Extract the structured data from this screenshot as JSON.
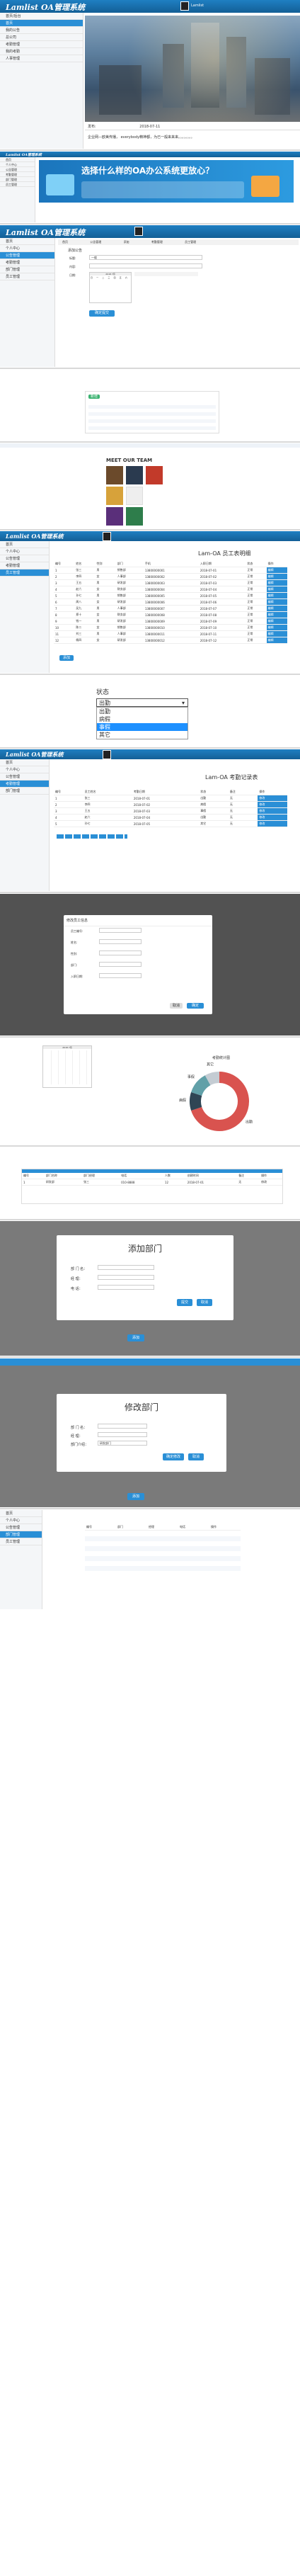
{
  "brand": "Lamlist OA管理系统",
  "user_name": "Lamlist",
  "p1": {
    "side_items": [
      "首页/后台",
      "首页",
      "我的公告",
      "总公司",
      "考勤管理",
      "我的考勤",
      "人事管理"
    ],
    "news_date_label": "发布:",
    "news_date": "2018-07-11",
    "news_text": "企业网—欧美传播， everybody精神都，为已一般来来来。。。。。。。。"
  },
  "p2": {
    "banner_text": "选择什么样的OA办公系统更放心？",
    "side_items": [
      "首页",
      "个人中心",
      "公告管理",
      "考勤管理",
      "部门管理",
      "员工管理"
    ]
  },
  "p3": {
    "tabs": [
      "首页",
      "公告管理",
      "添加",
      "考勤管理",
      "员工管理"
    ],
    "form_title": "添加公告",
    "labels": [
      "标题:",
      "内容:",
      "日期:"
    ],
    "title_val": "一般",
    "calendar_month": "2018 7月",
    "week": [
      "日",
      "一",
      "二",
      "三",
      "四",
      "五",
      "六"
    ],
    "submit": "确定提交"
  },
  "p4": {
    "tab": "公告列表",
    "btn": "新增"
  },
  "p5": {
    "heading": "MEET OUR TEAM"
  },
  "p6": {
    "table_title": "Lam-OA 员工表明细",
    "columns": [
      "编号",
      "姓名",
      "性别",
      "部门",
      "手机",
      "入职日期",
      "状态",
      "操作"
    ],
    "rows": [
      [
        "1",
        "张三",
        "男",
        "销售部",
        "13800000001",
        "2018-07-01",
        "正常",
        "编辑"
      ],
      [
        "2",
        "李四",
        "女",
        "人事部",
        "13800000002",
        "2018-07-02",
        "正常",
        "编辑"
      ],
      [
        "3",
        "王五",
        "男",
        "研发部",
        "13800000003",
        "2018-07-03",
        "正常",
        "编辑"
      ],
      [
        "4",
        "赵六",
        "女",
        "财务部",
        "13800000004",
        "2018-07-04",
        "正常",
        "编辑"
      ],
      [
        "5",
        "孙七",
        "男",
        "销售部",
        "13800000005",
        "2018-07-05",
        "正常",
        "编辑"
      ],
      [
        "6",
        "周八",
        "女",
        "研发部",
        "13800000006",
        "2018-07-06",
        "正常",
        "编辑"
      ],
      [
        "7",
        "吴九",
        "男",
        "人事部",
        "13800000007",
        "2018-07-07",
        "正常",
        "编辑"
      ],
      [
        "8",
        "郑十",
        "女",
        "财务部",
        "13800000008",
        "2018-07-08",
        "正常",
        "编辑"
      ],
      [
        "9",
        "钱一",
        "男",
        "研发部",
        "13800000009",
        "2018-07-09",
        "正常",
        "编辑"
      ],
      [
        "10",
        "陈二",
        "女",
        "销售部",
        "13800000010",
        "2018-07-10",
        "正常",
        "编辑"
      ],
      [
        "11",
        "刘三",
        "男",
        "人事部",
        "13800000011",
        "2018-07-11",
        "正常",
        "编辑"
      ],
      [
        "12",
        "杨四",
        "女",
        "研发部",
        "13800000012",
        "2018-07-12",
        "正常",
        "编辑"
      ]
    ],
    "btn": "添加"
  },
  "p7": {
    "label": "状态",
    "selected": "出勤",
    "options": [
      "出勤",
      "病假",
      "事假",
      "其它"
    ]
  },
  "p8": {
    "table_title": "Lam-OA 考勤记录表",
    "columns": [
      "编号",
      "员工姓名",
      "考勤日期",
      "状态",
      "备注",
      "操作"
    ],
    "rows": [
      [
        "1",
        "张三",
        "2018-07-01",
        "出勤",
        "无",
        "修改"
      ],
      [
        "2",
        "李四",
        "2018-07-02",
        "病假",
        "无",
        "修改"
      ],
      [
        "3",
        "王五",
        "2018-07-03",
        "事假",
        "无",
        "修改"
      ],
      [
        "4",
        "赵六",
        "2018-07-04",
        "出勤",
        "无",
        "修改"
      ],
      [
        "5",
        "孙七",
        "2018-07-05",
        "其它",
        "无",
        "修改"
      ]
    ]
  },
  "p9": {
    "dialog_title": "修改员工信息",
    "fields": [
      "员工编号:",
      "姓名:",
      "性别:",
      "部门:",
      "入职日期:"
    ],
    "cancel": "取消",
    "ok": "确定"
  },
  "p10": {
    "chart_title": "考勤统计图",
    "calendar_month": "2018 7月"
  },
  "p11": {
    "columns": [
      "编号",
      "部门名称",
      "部门经理",
      "电话",
      "人数",
      "创建时间",
      "备注",
      "操作"
    ],
    "row": [
      "1",
      "研发部",
      "张三",
      "010-8888",
      "12",
      "2018-07-01",
      "无",
      "修改"
    ]
  },
  "p12": {
    "dialog_title": "添加部门",
    "labels": [
      "部 门 名：",
      "经    理：",
      "电    话："
    ],
    "ok": "提交",
    "cancel": "取消",
    "bottom_btn": "添加"
  },
  "p13": {
    "dialog_title": "修改部门",
    "labels": [
      "部 门 名：",
      "经    理：",
      "部门介绍："
    ],
    "note_val": "研发部门",
    "ok": "确定修改",
    "cancel": "取消",
    "bottom_btn": "添加"
  },
  "p14": {
    "columns": [
      "编号",
      "部门",
      "经理",
      "电话",
      "操作"
    ]
  },
  "chart_data": {
    "type": "pie",
    "title": "考勤统计图",
    "categories": [
      "出勤",
      "病假",
      "事假",
      "其它"
    ],
    "values": [
      70,
      10,
      12,
      8
    ],
    "colors": [
      "#d9534f",
      "#2f4554",
      "#61a0a8",
      "#c4ccd3"
    ]
  }
}
